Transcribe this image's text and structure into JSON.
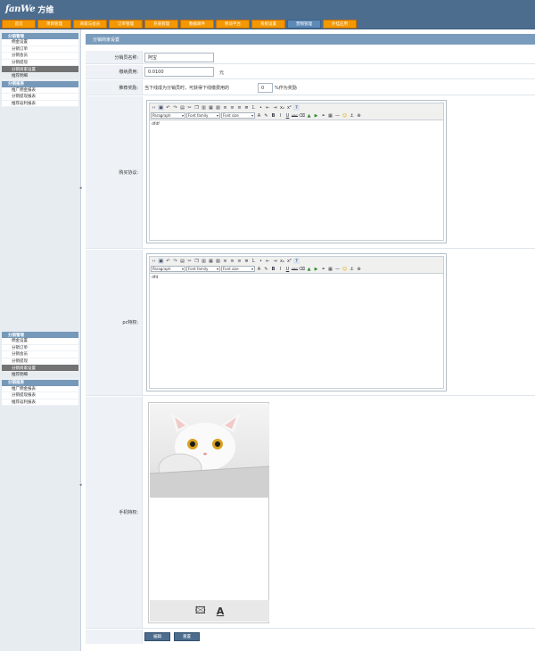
{
  "header": {
    "logo_latin": "fanWe",
    "logo_cn": "方维",
    "nav": [
      "首页",
      "项目管理",
      "商家与会员",
      "订单管理",
      "充值管理",
      "数据邮件",
      "移动平台",
      "系统设置",
      "营销管理",
      "外挂应用"
    ]
  },
  "sidebar": {
    "group1": {
      "head": "分销管理",
      "items": [
        "佣金设置",
        "分销订单",
        "分销会员",
        "分销提现",
        "分销商家设置"
      ],
      "extra": "推荐明细"
    },
    "group2": {
      "head": "分销报表",
      "items": [
        "推广佣金报表",
        "分销提现报表",
        "推荐返利报表"
      ]
    }
  },
  "main": {
    "section_title": "分销商家设置",
    "fields": {
      "name_label": "分销员名称:",
      "name_value": "阿宝",
      "fee_label": "缴纳费用:",
      "fee_value": "0.0100",
      "fee_unit": "元",
      "reward_label": "推荐奖励:",
      "reward_prefix": "当下线成为分销员时，可获得下线缴费用的",
      "reward_value": "0",
      "reward_suffix": "%作为奖励",
      "agreement_label": "购买协议:",
      "agreement_content": "dfdf",
      "pc_label": "pc特权:",
      "pc_content": "dfd",
      "mobile_label": "手机特权:"
    },
    "editor": {
      "format": "Paragraph",
      "font_family": "Font family",
      "font_size": "Font size"
    },
    "buttons": {
      "submit": "编辑",
      "reset": "重置"
    }
  },
  "colors": {
    "header": "#4d6d8e",
    "nav_tab": "#f39800",
    "nav_active": "#5d89b6",
    "side_head": "#7799b9",
    "section": "#7a9cbc"
  }
}
